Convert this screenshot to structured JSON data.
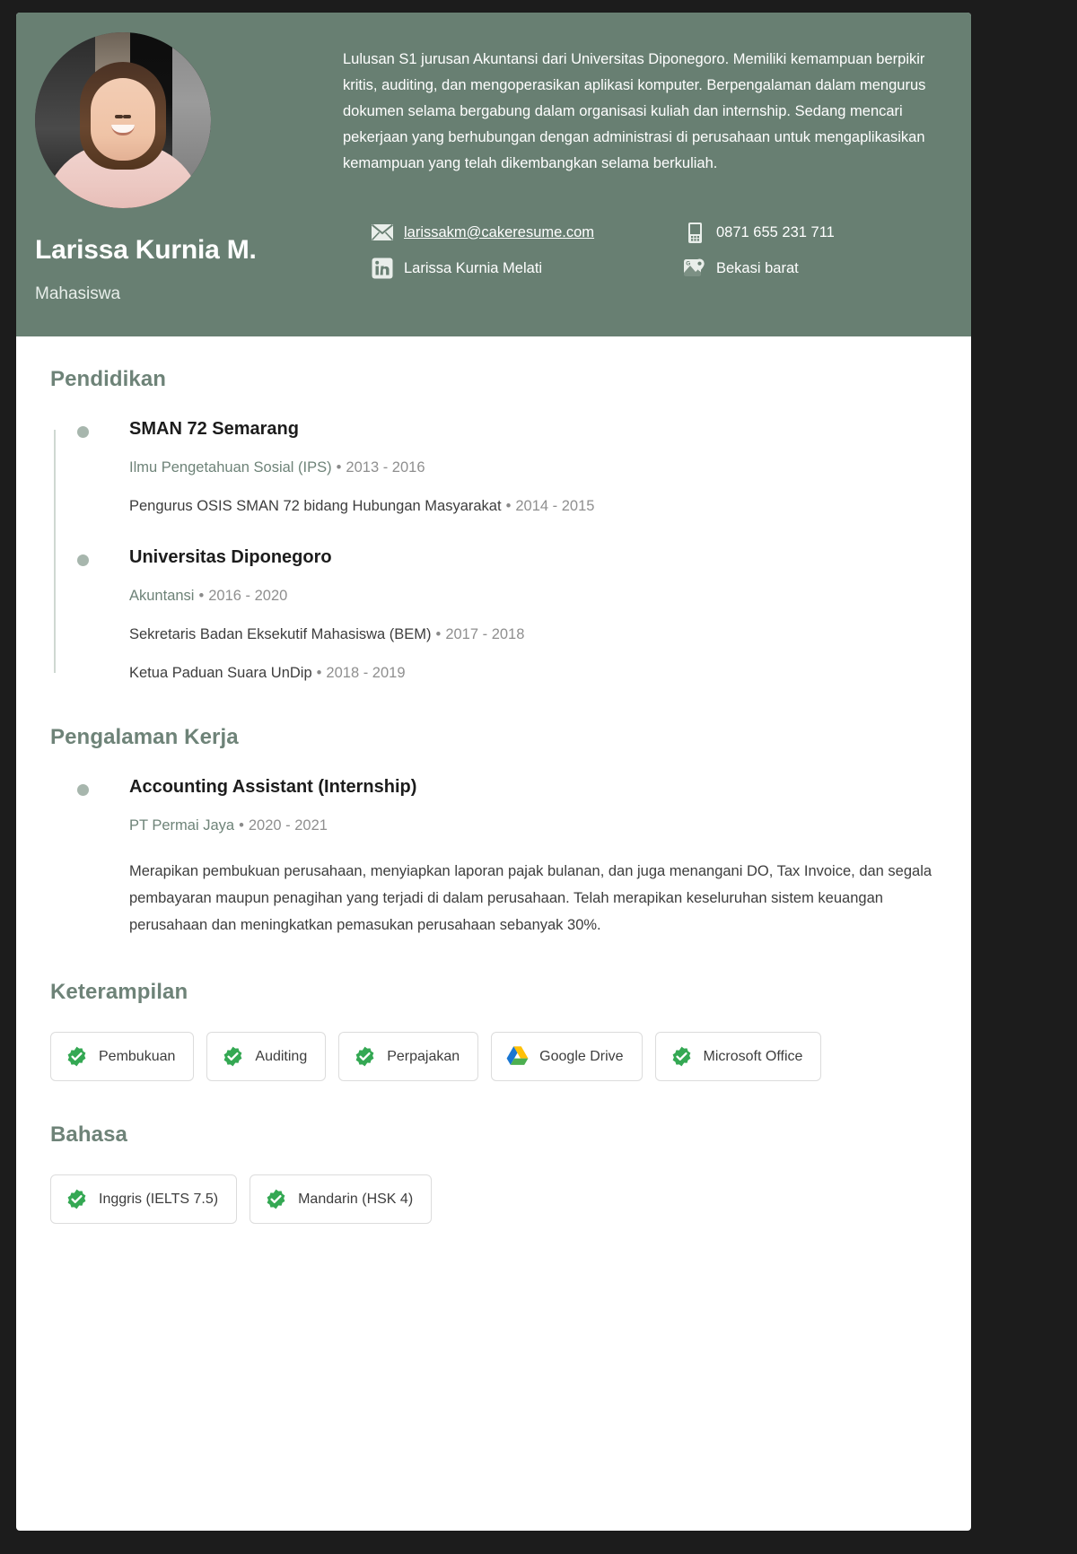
{
  "theme": {
    "header_bg": "#687f72",
    "accent_green": "#6e8378",
    "badge_green": "#34a853",
    "page_bg": "#ffffff",
    "canvas_bg": "#1c1c1c"
  },
  "header": {
    "name": "Larissa Kurnia M.",
    "role": "Mahasiswa",
    "avatar_alt": "profile-photo",
    "summary": "Lulusan S1 jurusan Akuntansi dari Universitas Diponegoro. Memiliki kemampuan berpikir kritis, auditing, dan mengoperasikan aplikasi komputer. Berpengalaman dalam mengurus dokumen selama bergabung dalam organisasi kuliah dan internship. Sedang mencari pekerjaan yang berhubungan dengan administrasi di perusahaan untuk mengaplikasikan kemampuan yang telah dikembangkan selama berkuliah.",
    "contacts": {
      "email": {
        "icon": "envelope-icon",
        "value": "larissakm@cakeresume.com"
      },
      "phone": {
        "icon": "mobile-phone-icon",
        "value": "0871 655 231 711"
      },
      "linkedin": {
        "icon": "linkedin-icon",
        "value": "Larissa Kurnia Melati"
      },
      "location": {
        "icon": "google-maps-pin-icon",
        "value": "Bekasi barat"
      }
    }
  },
  "sections": {
    "education": {
      "title": "Pendidikan",
      "entries": [
        {
          "school": "SMAN 72 Semarang",
          "major": "Ilmu Pengetahuan Sosial (IPS)",
          "major_dates": "2013 - 2016",
          "activity": "Pengurus OSIS SMAN 72 bidang Hubungan Masyarakat",
          "activity_dates": "2014 - 2015"
        },
        {
          "school": "Universitas Diponegoro",
          "major": "Akuntansi",
          "major_dates": "2016 - 2020",
          "activity": "Sekretaris Badan Eksekutif Mahasiswa (BEM)",
          "activity_dates": "2017 - 2018",
          "activity2": "Ketua Paduan Suara UnDip",
          "activity2_dates": "2018 - 2019"
        }
      ]
    },
    "experience": {
      "title": "Pengalaman Kerja",
      "entries": [
        {
          "position": "Accounting Assistant (Internship)",
          "company": "PT Permai Jaya",
          "dates": "2020 - 2021",
          "description": "Merapikan pembukuan perusahaan, menyiapkan laporan pajak bulanan, dan juga menangani DO, Tax Invoice, dan segala pembayaran maupun penagihan yang terjadi di dalam perusahaan. Telah merapikan keseluruhan sistem keuangan perusahaan dan meningkatkan pemasukan perusahaan sebanyak 30%."
        }
      ]
    },
    "skills": {
      "title": "Keterampilan",
      "items": [
        {
          "label": "Pembukuan",
          "icon": "verified-check-icon"
        },
        {
          "label": "Auditing",
          "icon": "verified-check-icon"
        },
        {
          "label": "Perpajakan",
          "icon": "verified-check-icon"
        },
        {
          "label": "Google Drive",
          "icon": "google-drive-icon"
        },
        {
          "label": "Microsoft Office",
          "icon": "verified-check-icon"
        }
      ]
    },
    "languages": {
      "title": "Bahasa",
      "items": [
        {
          "label": "Inggris (IELTS 7.5)",
          "icon": "verified-check-icon"
        },
        {
          "label": "Mandarin (HSK 4)",
          "icon": "verified-check-icon"
        }
      ]
    }
  },
  "separator": "•"
}
